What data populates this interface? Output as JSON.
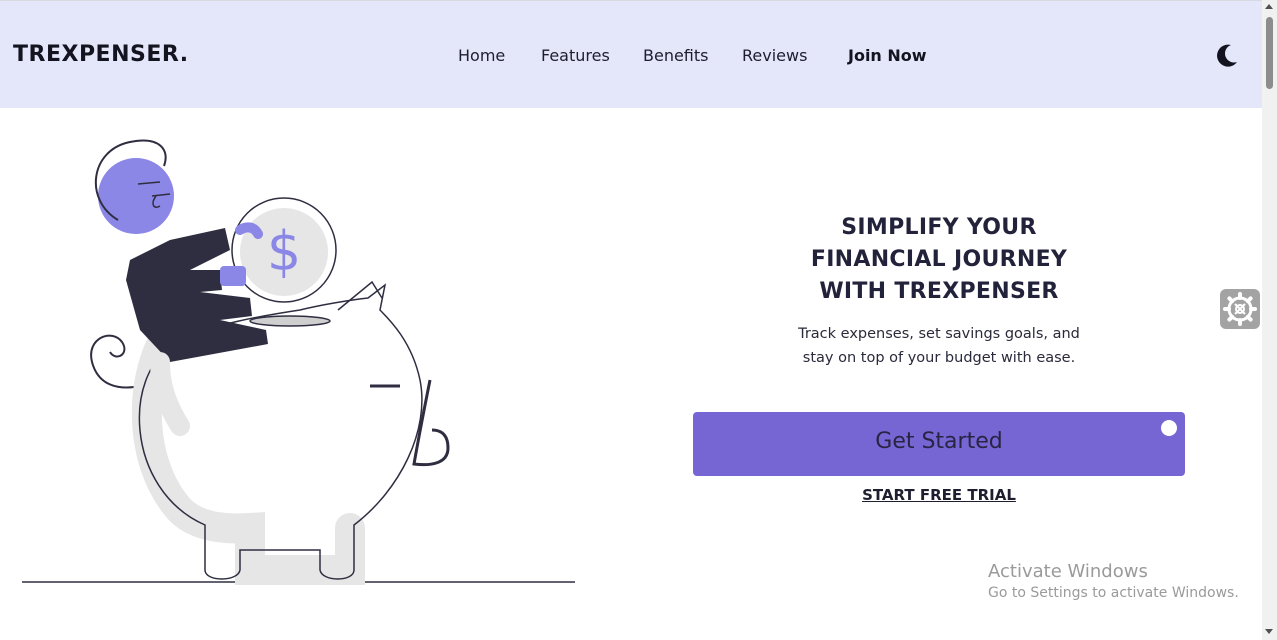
{
  "nav": {
    "brand": "TREXPENSER.",
    "links": [
      {
        "label": "Home"
      },
      {
        "label": "Features"
      },
      {
        "label": "Benefits"
      },
      {
        "label": "Reviews"
      },
      {
        "label": "Join Now"
      }
    ],
    "theme_icon": "moon-icon"
  },
  "hero": {
    "title": "SIMPLIFY YOUR FINANCIAL JOURNEY WITH TREXPENSER",
    "subtitle": "Track expenses, set savings goals, and stay on top of your budget with ease.",
    "cta_label": "Get Started",
    "trial_label": "START FREE TRIAL",
    "illustration_icon": "piggy-bank-illustration",
    "coin_symbol": "$"
  },
  "watermark": {
    "title": "Activate Windows",
    "subtitle": "Go to Settings to activate Windows."
  },
  "colors": {
    "accent": "#7566d4",
    "nav_bg": "#e4e6fa",
    "illustration_purple": "#8b87e6",
    "illustration_dark": "#2f2e41"
  }
}
